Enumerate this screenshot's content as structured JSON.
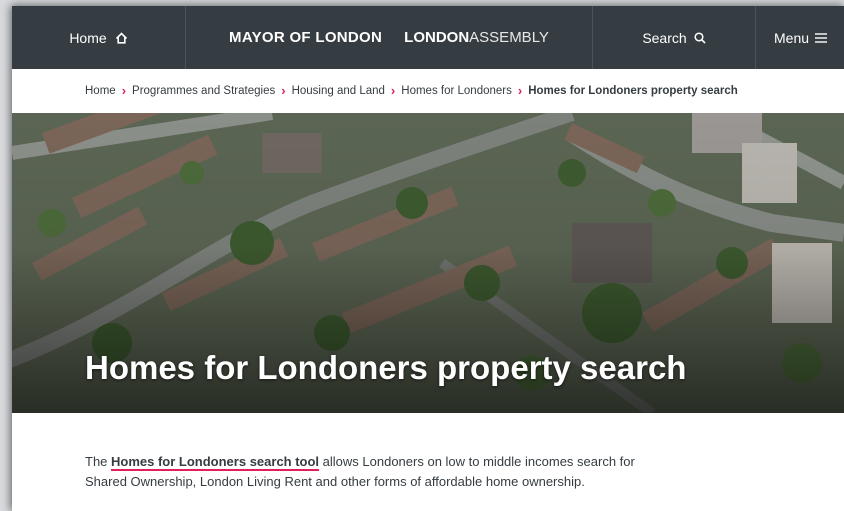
{
  "nav": {
    "home_label": "Home",
    "brand_mayor": "MAYOR OF LONDON",
    "brand_assembly_bold": "LONDON",
    "brand_assembly_light": "ASSEMBLY",
    "search_label": "Search",
    "menu_label": "Menu"
  },
  "breadcrumb": {
    "items": [
      "Home",
      "Programmes and Strategies",
      "Housing and Land",
      "Homes for Londoners",
      "Homes for Londoners property search"
    ]
  },
  "hero": {
    "title": "Homes for Londoners property search"
  },
  "intro": {
    "before": "The ",
    "link": "Homes for Londoners search tool",
    "after": " allows Londoners on low to middle incomes search for Shared Ownership, London Living Rent and other forms of affordable home ownership."
  },
  "colors": {
    "nav_bg": "#353d42",
    "accent": "#e21f5e",
    "text": "#353d42"
  },
  "icons": {
    "home": "home-icon",
    "search": "search-icon",
    "menu": "hamburger-icon",
    "separator": "chevron-right-icon"
  }
}
